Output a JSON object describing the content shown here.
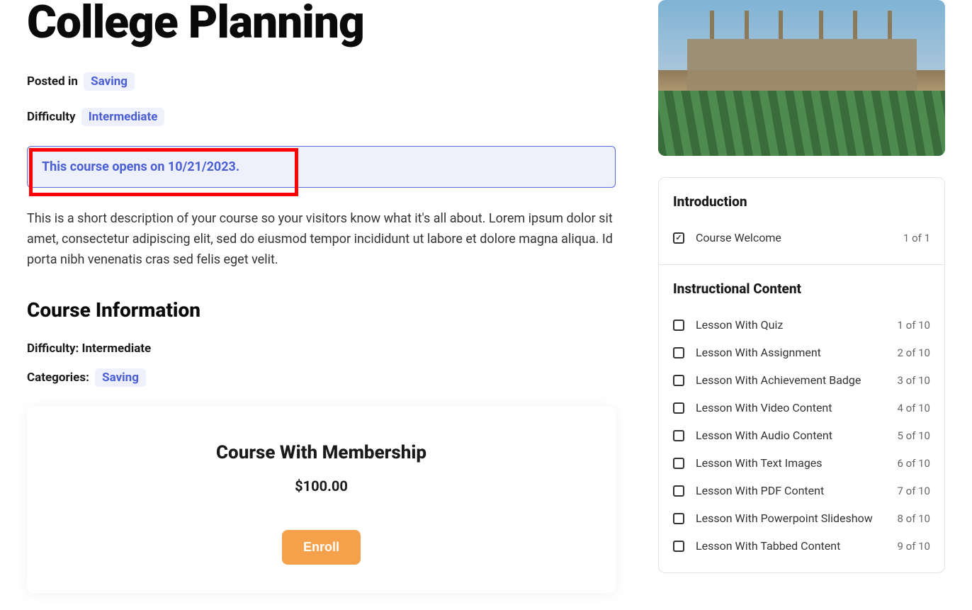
{
  "header": {
    "title": "College Planning",
    "posted_in_label": "Posted in",
    "posted_in_value": "Saving",
    "difficulty_label": "Difficulty",
    "difficulty_value": "Intermediate"
  },
  "notice": {
    "text": "This course opens on 10/21/2023."
  },
  "description": "This is a short description of your course so your visitors know what it's all about. Lorem ipsum dolor sit amet, consectetur adipiscing elit, sed do eiusmod tempor incididunt ut labore et dolore magna aliqua. Id porta nibh venenatis cras sed felis eget velit.",
  "course_info": {
    "heading": "Course Information",
    "difficulty_label": "Difficulty: Intermediate",
    "categories_label": "Categories:",
    "categories_value": "Saving"
  },
  "membership": {
    "title": "Course With Membership",
    "price": "$100.00",
    "enroll_label": "Enroll"
  },
  "outline": {
    "sections": [
      {
        "heading": "Introduction",
        "lessons": [
          {
            "title": "Course Welcome",
            "progress": "1 of 1",
            "checked": true
          }
        ]
      },
      {
        "heading": "Instructional Content",
        "lessons": [
          {
            "title": "Lesson With Quiz",
            "progress": "1 of 10",
            "checked": false
          },
          {
            "title": "Lesson With Assignment",
            "progress": "2 of 10",
            "checked": false
          },
          {
            "title": "Lesson With Achievement Badge",
            "progress": "3 of 10",
            "checked": false
          },
          {
            "title": "Lesson With Video Content",
            "progress": "4 of 10",
            "checked": false
          },
          {
            "title": "Lesson With Audio Content",
            "progress": "5 of 10",
            "checked": false
          },
          {
            "title": "Lesson With Text Images",
            "progress": "6 of 10",
            "checked": false
          },
          {
            "title": "Lesson With PDF Content",
            "progress": "7 of 10",
            "checked": false
          },
          {
            "title": "Lesson With Powerpoint Slideshow",
            "progress": "8 of 10",
            "checked": false
          },
          {
            "title": "Lesson With Tabbed Content",
            "progress": "9 of 10",
            "checked": false
          }
        ]
      }
    ]
  }
}
